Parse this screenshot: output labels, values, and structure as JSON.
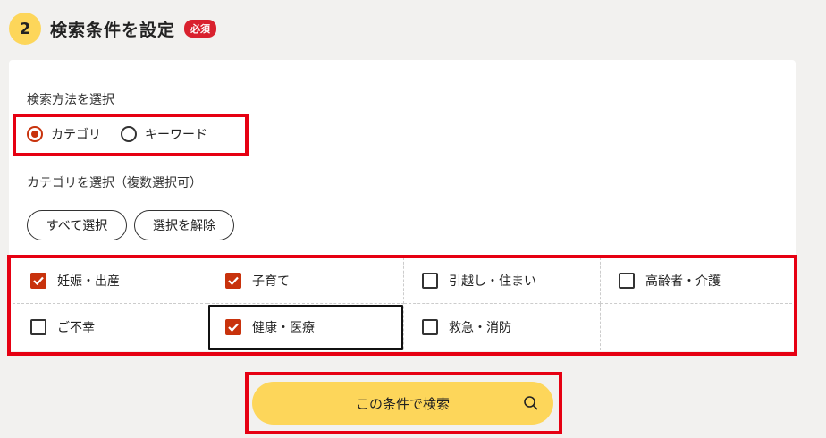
{
  "step": {
    "number": "2",
    "title": "検索条件を設定",
    "required_badge": "必須"
  },
  "search_method": {
    "label": "検索方法を選択",
    "options": [
      {
        "label": "カテゴリ",
        "selected": true
      },
      {
        "label": "キーワード",
        "selected": false
      }
    ]
  },
  "category_select": {
    "label": "カテゴリを選択（複数選択可）",
    "select_all_label": "すべて選択",
    "clear_label": "選択を解除",
    "items": [
      {
        "label": "妊娠・出産",
        "checked": true
      },
      {
        "label": "子育て",
        "checked": true
      },
      {
        "label": "引越し・住まい",
        "checked": false
      },
      {
        "label": "高齢者・介護",
        "checked": false
      },
      {
        "label": "ご不幸",
        "checked": false
      },
      {
        "label": "健康・医療",
        "checked": true
      },
      {
        "label": "救急・消防",
        "checked": false
      }
    ]
  },
  "search_button": {
    "label": "この条件で検索",
    "icon": "search-icon"
  },
  "colors": {
    "accent": "#fdd65a",
    "check": "#c8320c",
    "highlight": "#e60012",
    "badge": "#d9212e"
  }
}
